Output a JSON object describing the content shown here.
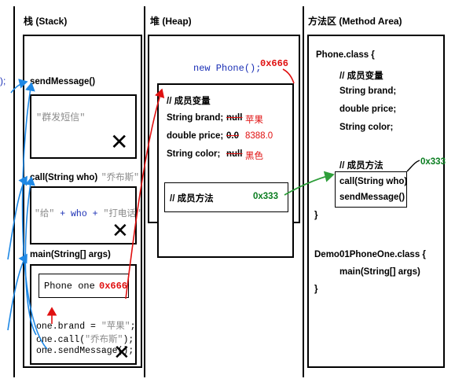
{
  "headers": {
    "stack": "栈 (Stack)",
    "heap": "堆 (Heap)",
    "method_area": "方法区 (Method Area)"
  },
  "left_fragment": ");",
  "stack": {
    "send_message": {
      "title": "sendMessage()",
      "body": "\"群发短信\""
    },
    "call": {
      "title": "call(String who)",
      "param": "\"乔布斯\"",
      "body_str1": "\"给\"",
      "body_plus1": " + who + ",
      "body_str2": "\"打电话\""
    },
    "main": {
      "title": "main(String[] args)",
      "var_type": "Phone one",
      "var_value": "0x666",
      "line1": "one.brand = ",
      "line1_str": "\"苹果\"",
      "line1_end": ";",
      "line2": "one.call(",
      "line2_str": "\"乔布斯\"",
      "line2_end": ");",
      "line3": "one.sendMessage();"
    }
  },
  "heap": {
    "new_keyword": "new",
    "new_rest": " Phone();",
    "address": "0x666",
    "fields_comment": "// 成员变量",
    "fields": [
      {
        "label": "String brand;",
        "old": "null",
        "new": "苹果"
      },
      {
        "label": "double price;",
        "old": "0.0",
        "new": "8388.0"
      },
      {
        "label": "String color;",
        "old": "null",
        "new": "黑色"
      }
    ],
    "methods_comment": "// 成员方法",
    "methods_address": "0x333"
  },
  "method_area": {
    "class_decl": "Phone.class {",
    "fields_comment": "// 成员变量",
    "fields": [
      "String brand;",
      "double price;",
      "String color;"
    ],
    "methods_comment": "// 成员方法",
    "methods": [
      "call(String who)",
      "sendMessage()"
    ],
    "methods_address": "0x333",
    "close_brace": "}",
    "demo_decl": "Demo01PhoneOne.class {",
    "demo_method": "main(String[] args)",
    "demo_close": "}"
  },
  "colors": {
    "arrow_blue": "#1e88e5",
    "arrow_red": "#e01010",
    "arrow_green": "#2e9e3a"
  }
}
